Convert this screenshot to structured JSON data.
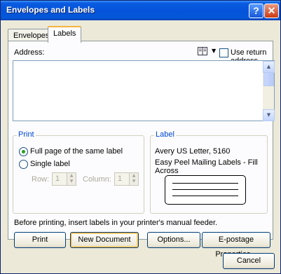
{
  "window": {
    "title": "Envelopes and Labels",
    "help_glyph": "?",
    "close_glyph": "✕"
  },
  "tabs": [
    {
      "label": "Envelopes",
      "active": false
    },
    {
      "label": "Labels",
      "active": true
    }
  ],
  "address": {
    "label": "Address:",
    "value": "",
    "use_return_address_label": "Use return address",
    "use_return_address_checked": false
  },
  "print_group": {
    "title": "Print",
    "full_page_label": "Full page of the same label",
    "single_label_label": "Single label",
    "selected": "full_page",
    "row_label": "Row:",
    "row_value": "1",
    "column_label": "Column:",
    "column_value": "1"
  },
  "label_group": {
    "title": "Label",
    "line1": "Avery US Letter, 5160",
    "line2": "Easy Peel Mailing Labels - Fill Across"
  },
  "info_text": "Before printing, insert labels in your printer's manual feeder.",
  "buttons": {
    "print": "Print",
    "new_document": "New Document",
    "options": "Options...",
    "epostage": "E-postage Properties...",
    "cancel": "Cancel"
  },
  "colors": {
    "titlebar": "#0553db",
    "group_title": "#0046d5",
    "radio_dot": "#21a121",
    "default_button_glow": "#f5b94a"
  }
}
